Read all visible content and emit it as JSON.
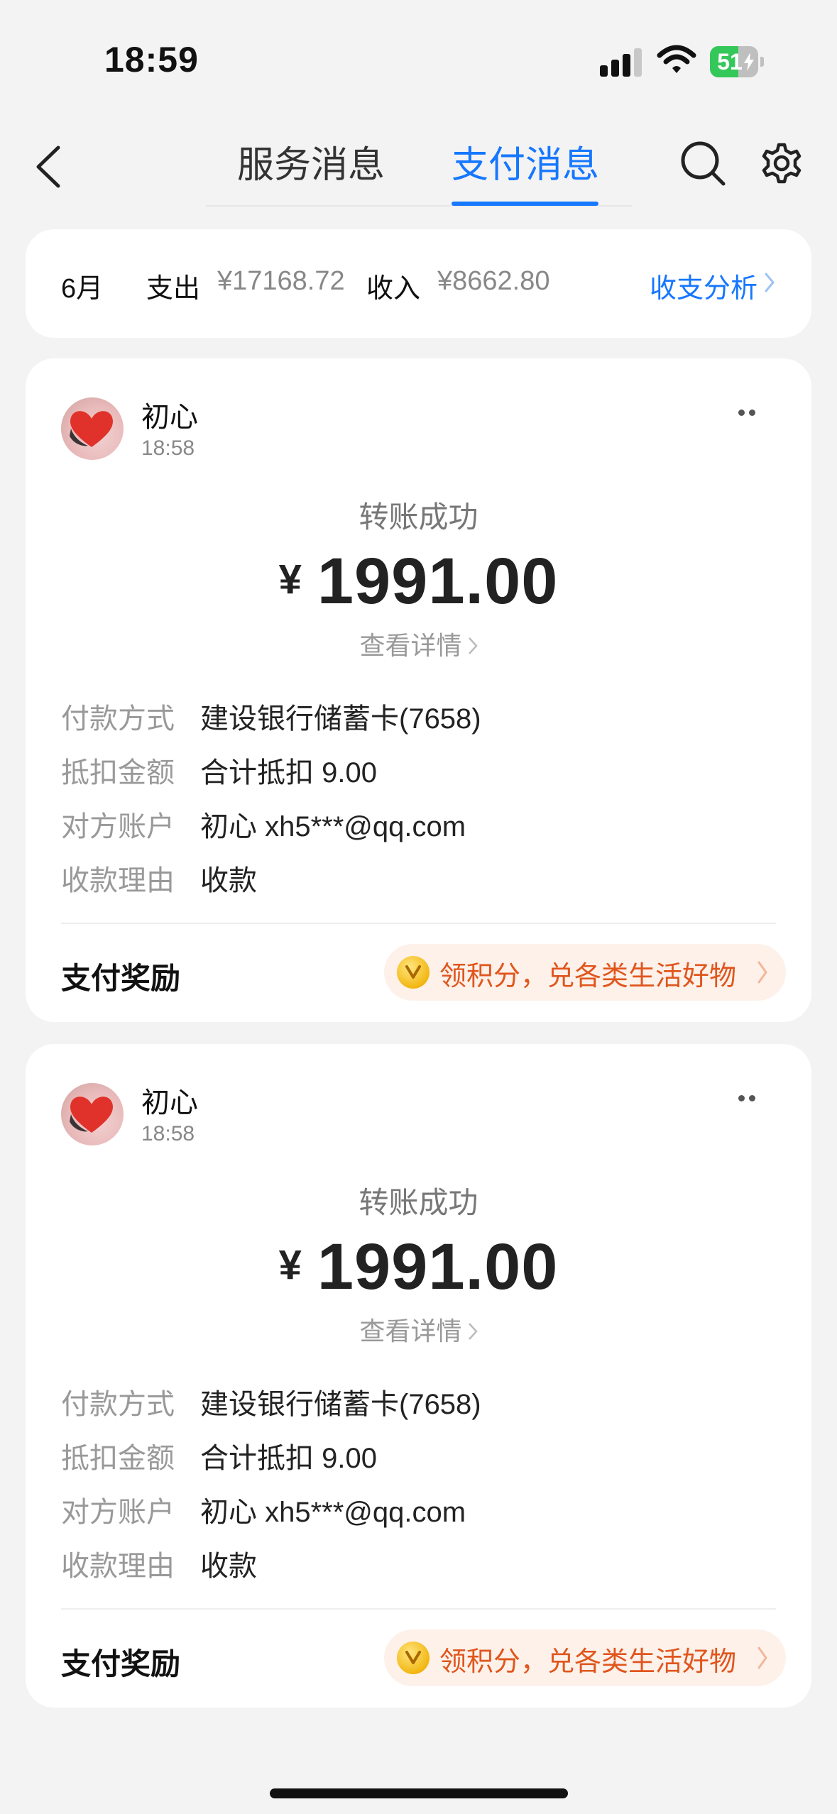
{
  "status_bar": {
    "time": "18:59",
    "battery": "51"
  },
  "nav": {
    "tabs": [
      {
        "label": "服务消息"
      },
      {
        "label": "支付消息"
      }
    ],
    "active_tab": "支付消息"
  },
  "summary": {
    "month": "6月",
    "expense_label": "支出",
    "expense_value": "¥17168.72",
    "income_label": "收入",
    "income_value": "¥8662.80",
    "analysis_label": "收支分析"
  },
  "cards": [
    {
      "name": "初心",
      "time": "18:58",
      "status": "转账成功",
      "currency": "¥",
      "amount": "1991.00",
      "details_label": "查看详情",
      "rows": [
        {
          "key": "付款方式",
          "value": "建设银行储蓄卡(7658)"
        },
        {
          "key": "抵扣金额",
          "value": "合计抵扣 9.00"
        },
        {
          "key": "对方账户",
          "value": "初心 xh5***@qq.com"
        },
        {
          "key": "收款理由",
          "value": "收款"
        }
      ],
      "reward_label": "支付奖励",
      "reward_text": "领积分，兑各类生活好物"
    },
    {
      "name": "初心",
      "time": "18:58",
      "status": "转账成功",
      "currency": "¥",
      "amount": "1991.00",
      "details_label": "查看详情",
      "rows": [
        {
          "key": "付款方式",
          "value": "建设银行储蓄卡(7658)"
        },
        {
          "key": "抵扣金额",
          "value": "合计抵扣 9.00"
        },
        {
          "key": "对方账户",
          "value": "初心 xh5***@qq.com"
        },
        {
          "key": "收款理由",
          "value": "收款"
        }
      ],
      "reward_label": "支付奖励",
      "reward_text": "领积分，兑各类生活好物"
    }
  ],
  "colors": {
    "accent": "#1677ff",
    "reward": "#e0561d",
    "background": "#f3f3f3"
  },
  "icons": [
    "back-chevron-icon",
    "search-icon",
    "gear-icon",
    "more-dots-icon",
    "coin-icon",
    "chevron-right-icon",
    "heart-avatar"
  ]
}
